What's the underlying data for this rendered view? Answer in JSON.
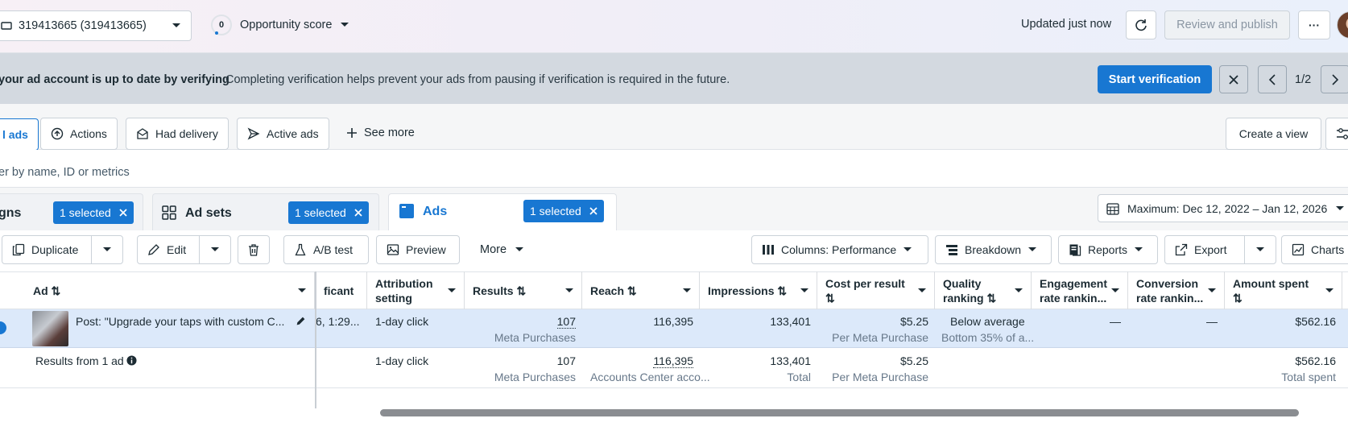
{
  "topbar": {
    "account_label": "319413665 (319413665)",
    "opportunity_count": "0",
    "opportunity_label": "Opportunity score",
    "updated_text": "Updated just now",
    "review_publish_label": "Review and publish",
    "more_label": "···"
  },
  "banner": {
    "title": "your ad account is up to date by verifying",
    "message": "Completing verification helps prevent your ads from pausing if verification is required in the future.",
    "cta_label": "Start verification",
    "pagination": "1/2"
  },
  "filters": {
    "all_ads_label": "l ads",
    "actions_label": "Actions",
    "had_delivery_label": "Had delivery",
    "active_ads_label": "Active ads",
    "see_more_label": "See more",
    "create_view_label": "Create a view",
    "search_placeholder": "er by name, ID or metrics"
  },
  "tabs": {
    "campaigns_label": "gns",
    "campaigns_selected": "1 selected",
    "adsets_label": "Ad sets",
    "adsets_selected": "1 selected",
    "ads_label": "Ads",
    "ads_selected": "1 selected",
    "date_range": "Maximum: Dec 12, 2022 – Jan 12, 2026"
  },
  "toolbar": {
    "duplicate": "Duplicate",
    "edit": "Edit",
    "ab_test": "A/B test",
    "preview": "Preview",
    "more": "More",
    "columns": "Columns: Performance",
    "breakdown": "Breakdown",
    "reports": "Reports",
    "export": "Export",
    "charts": "Charts"
  },
  "table": {
    "headers": {
      "ad": "Ad ⇅",
      "significant": "ficant",
      "attribution_1": "Attribution",
      "attribution_2": "setting",
      "results": "Results ⇅",
      "reach": "Reach ⇅",
      "impressions": "Impressions ⇅",
      "cost_1": "Cost per result",
      "cost_2": "⇅",
      "quality_1": "Quality",
      "quality_2": "ranking ⇅",
      "engagement_1": "Engagement",
      "engagement_2": "rate rankin...",
      "conversion_1": "Conversion",
      "conversion_2": "rate rankin...",
      "amount_1": "Amount spent",
      "amount_2": "⇅"
    },
    "row": {
      "ad_name": "Post: \"Upgrade your taps with custom C...",
      "significant": "6, 1:29...",
      "attribution": "1-day click",
      "results": "107",
      "results_sub": "Meta Purchases",
      "reach": "116,395",
      "impressions": "133,401",
      "cost": "$5.25",
      "cost_sub": "Per Meta Purchase",
      "quality": "Below average",
      "quality_sub": "Bottom 35% of a...",
      "engagement": "—",
      "conversion": "—",
      "amount": "$562.16"
    },
    "summary": {
      "label": "Results from 1 ad",
      "attribution": "1-day click",
      "results": "107",
      "results_sub": "Meta Purchases",
      "reach": "116,395",
      "reach_sub": "Accounts Center acco...",
      "impressions": "133,401",
      "impressions_sub": "Total",
      "cost": "$5.25",
      "cost_sub": "Per Meta Purchase",
      "amount": "$562.16",
      "amount_sub": "Total spent"
    }
  },
  "colors": {
    "primary": "#1877d2",
    "banner_bg": "#d3d9e0",
    "selected_row": "#dce9fa"
  }
}
